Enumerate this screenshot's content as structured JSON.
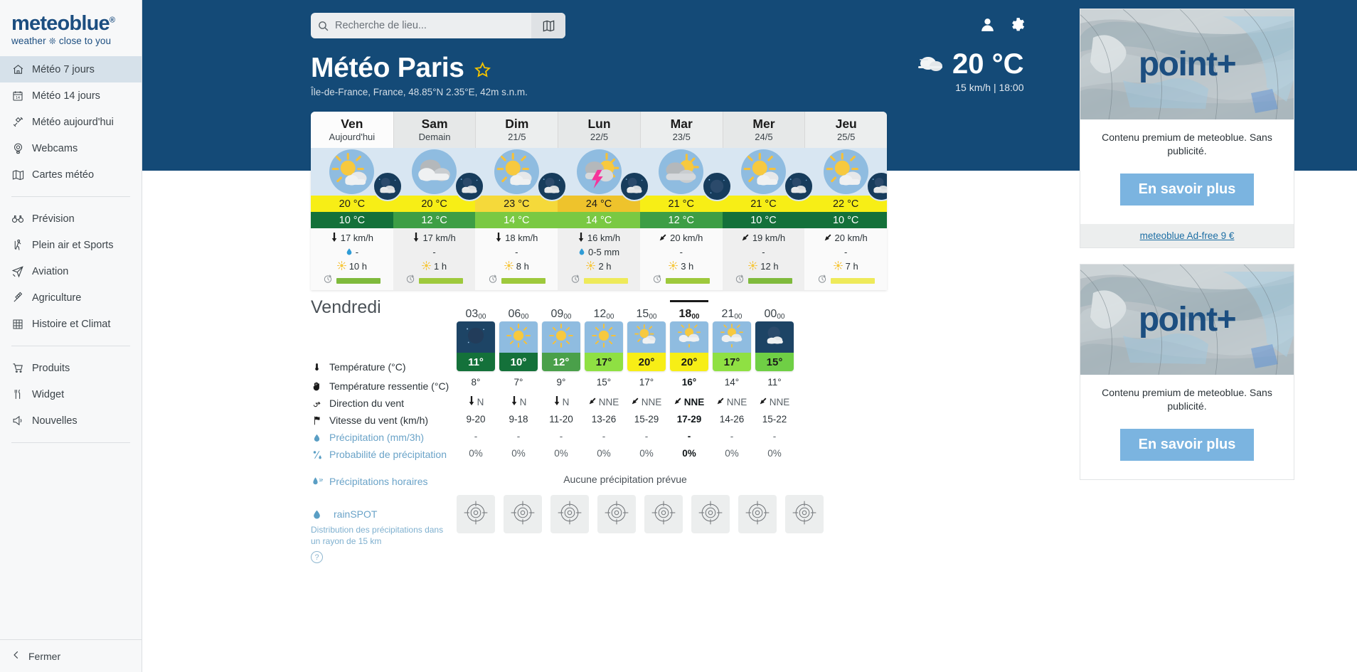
{
  "sidebar": {
    "logo": {
      "name": "meteoblue",
      "reg": "®",
      "tagline_left": "weather",
      "tagline_right": "close to you"
    },
    "items": [
      {
        "label": "Météo 7 jours",
        "icon": "home-icon",
        "active": true
      },
      {
        "label": "Météo 14 jours",
        "icon": "calendar-14-icon",
        "active": false
      },
      {
        "label": "Météo aujourd'hui",
        "icon": "satellite-icon",
        "active": false
      },
      {
        "label": "Webcams",
        "icon": "webcam-icon",
        "active": false
      },
      {
        "label": "Cartes météo",
        "icon": "map-icon",
        "active": false
      }
    ],
    "items2": [
      {
        "label": "Prévision",
        "icon": "binoculars-icon"
      },
      {
        "label": "Plein air et Sports",
        "icon": "hiker-icon"
      },
      {
        "label": "Aviation",
        "icon": "airplane-icon"
      },
      {
        "label": "Agriculture",
        "icon": "wheat-icon"
      },
      {
        "label": "Histoire et Climat",
        "icon": "table-icon"
      }
    ],
    "items3": [
      {
        "label": "Produits",
        "icon": "cart-icon"
      },
      {
        "label": "Widget",
        "icon": "tools-icon"
      },
      {
        "label": "Nouvelles",
        "icon": "megaphone-icon"
      }
    ],
    "close_label": "Fermer",
    "close_icon": "chevron-left-icon"
  },
  "header": {
    "search_placeholder": "Recherche de lieu...",
    "search_value": "",
    "search_icon": "search-icon",
    "map_icon": "map-book-icon",
    "user_icon": "user-icon",
    "gear_icon": "gear-icon",
    "title": "Météo Paris",
    "favorite_icon": "star-icon",
    "subtitle": "Île-de-France, France, 48.85°N 2.35°E, 42m s.n.m.",
    "current": {
      "icon": "cloudy-icon",
      "temperature": "20 °C",
      "meta": "15 km/h  | 18:00"
    }
  },
  "forecast": {
    "days": [
      {
        "name": "Ven",
        "date": "Aujourd'hui",
        "today": true,
        "day_icon": "sun-cloud-icon",
        "night_icon": "night-cloud-icon",
        "tmax": "20 °C",
        "tmin": "10 °C",
        "tmax_color": "#f7ee16",
        "tmin_color": "#14713a",
        "wind": "17 km/h",
        "wind_icon": "arrow-down-icon",
        "precip": "-",
        "precip_icon": "droplet-icon",
        "sun": "10 h",
        "sun_icon": "sun-small-icon",
        "bar_color": "#7fba3c",
        "bar_icon": "predictability-icon"
      },
      {
        "name": "Sam",
        "date": "Demain",
        "today": false,
        "day_icon": "clouds-icon",
        "night_icon": "night-cloud-icon",
        "tmax": "20 °C",
        "tmin": "12 °C",
        "tmax_color": "#f7ee16",
        "tmin_color": "#3d9e45",
        "wind": "17 km/h",
        "wind_icon": "arrow-down-icon",
        "precip": "-",
        "precip_icon": "none",
        "sun": "1 h",
        "sun_icon": "sun-small-icon",
        "bar_color": "#9ec93c",
        "bar_icon": "predictability-icon"
      },
      {
        "name": "Dim",
        "date": "21/5",
        "today": false,
        "day_icon": "sun-cloud-icon",
        "night_icon": "night-cloud-icon",
        "tmax": "23 °C",
        "tmin": "14 °C",
        "tmax_color": "#f5d93a",
        "tmin_color": "#7ac943",
        "wind": "18 km/h",
        "wind_icon": "arrow-down-icon",
        "precip": "-",
        "precip_icon": "none",
        "sun": "8 h",
        "sun_icon": "sun-small-icon",
        "bar_color": "#9ec93c",
        "bar_icon": "predictability-icon"
      },
      {
        "name": "Lun",
        "date": "22/5",
        "today": false,
        "day_icon": "thunder-sun-icon",
        "night_icon": "night-cloud-icon",
        "tmax": "24 °C",
        "tmin": "14 °C",
        "tmax_color": "#eec32c",
        "tmin_color": "#7ac943",
        "wind": "16 km/h",
        "wind_icon": "arrow-down-icon",
        "precip": "0-5 mm",
        "precip_icon": "droplet-icon",
        "sun": "2 h",
        "sun_icon": "sun-small-icon",
        "bar_color": "#eeea5a",
        "bar_icon": "predictability-icon"
      },
      {
        "name": "Mar",
        "date": "23/5",
        "today": false,
        "day_icon": "cloud-sun-icon",
        "night_icon": "night-moon-icon",
        "tmax": "21 °C",
        "tmin": "12 °C",
        "tmax_color": "#f7ee16",
        "tmin_color": "#3d9e45",
        "wind": "20 km/h",
        "wind_icon": "arrow-diag-icon",
        "precip": "-",
        "precip_icon": "none",
        "sun": "3 h",
        "sun_icon": "sun-small-icon",
        "bar_color": "#9ec93c",
        "bar_icon": "predictability-icon"
      },
      {
        "name": "Mer",
        "date": "24/5",
        "today": false,
        "day_icon": "sun-cloud-icon",
        "night_icon": "night-cloud-icon",
        "tmax": "21 °C",
        "tmin": "10 °C",
        "tmax_color": "#f7ee16",
        "tmin_color": "#14713a",
        "wind": "19 km/h",
        "wind_icon": "arrow-diag-icon",
        "precip": "-",
        "precip_icon": "none",
        "sun": "12 h",
        "sun_icon": "sun-small-icon",
        "bar_color": "#7fba3c",
        "bar_icon": "predictability-icon"
      },
      {
        "name": "Jeu",
        "date": "25/5",
        "today": false,
        "day_icon": "sun-cloud-icon",
        "night_icon": "night-cloud-icon",
        "tmax": "22 °C",
        "tmin": "10 °C",
        "tmax_color": "#f7ee16",
        "tmin_color": "#14713a",
        "wind": "20 km/h",
        "wind_icon": "arrow-diag-icon",
        "precip": "-",
        "precip_icon": "none",
        "sun": "7 h",
        "sun_icon": "sun-small-icon",
        "bar_color": "#eeea5a",
        "bar_icon": "predictability-icon"
      }
    ]
  },
  "hourly": {
    "day_title": "Vendredi",
    "labels": [
      {
        "text": "Température (°C)",
        "icon": "thermometer-icon",
        "blue": false
      },
      {
        "text": "Température ressentie (°C)",
        "icon": "hand-icon",
        "blue": false
      },
      {
        "text": "Direction du vent",
        "icon": "windvane-icon",
        "blue": false
      },
      {
        "text": "Vitesse du vent (km/h)",
        "icon": "flag-icon",
        "blue": false
      },
      {
        "text": "Précipitation (mm/3h)",
        "icon": "droplet-icon",
        "blue": true
      },
      {
        "text": "Probabilité de précipitation",
        "icon": "percent-drop-icon",
        "blue": true
      }
    ],
    "hourly_precip_label": "Précipitations horaires",
    "hourly_precip_icon": "droplet-1h-icon",
    "rainspot_label": "rainSPOT",
    "rainspot_icon": "droplet-icon",
    "rainspot_note": "Distribution des précipitations dans un rayon de 15 km",
    "help_label": "?",
    "no_precip_text": "Aucune précipitation prévue",
    "columns": [
      {
        "time": "03",
        "time_sup": "00",
        "selected": false,
        "sky": "night",
        "icon": "moon-icon",
        "temp": "11°",
        "temp_bg": "#14713a",
        "temp_color": "#ffffff",
        "feels": "8°",
        "wind_dir": "N",
        "wind_dir_icon": "arrow-down-icon",
        "wind_speed": "9-20",
        "precip": "-",
        "precip_prob": "0%"
      },
      {
        "time": "06",
        "time_sup": "00",
        "selected": false,
        "sky": "day",
        "icon": "sun-icon",
        "temp": "10°",
        "temp_bg": "#14713a",
        "temp_color": "#ffffff",
        "feels": "7°",
        "wind_dir": "N",
        "wind_dir_icon": "arrow-down-icon",
        "wind_speed": "9-18",
        "precip": "-",
        "precip_prob": "0%"
      },
      {
        "time": "09",
        "time_sup": "00",
        "selected": false,
        "sky": "day",
        "icon": "sun-icon",
        "temp": "12°",
        "temp_bg": "#4aa04a",
        "temp_color": "#ffffff",
        "feels": "9°",
        "wind_dir": "N",
        "wind_dir_icon": "arrow-down-icon",
        "wind_speed": "11-20",
        "precip": "-",
        "precip_prob": "0%"
      },
      {
        "time": "12",
        "time_sup": "00",
        "selected": false,
        "sky": "day",
        "icon": "sun-icon",
        "temp": "17°",
        "temp_bg": "#8fe043",
        "temp_color": "#1a1a1a",
        "feels": "15°",
        "wind_dir": "NNE",
        "wind_dir_icon": "arrow-diag-icon",
        "wind_speed": "13-26",
        "precip": "-",
        "precip_prob": "0%"
      },
      {
        "time": "15",
        "time_sup": "00",
        "selected": false,
        "sky": "day",
        "icon": "sun-cloud-icon",
        "temp": "20°",
        "temp_bg": "#f7ee16",
        "temp_color": "#1a1a1a",
        "feels": "17°",
        "wind_dir": "NNE",
        "wind_dir_icon": "arrow-diag-icon",
        "wind_speed": "15-29",
        "precip": "-",
        "precip_prob": "0%"
      },
      {
        "time": "18",
        "time_sup": "00",
        "selected": true,
        "sky": "day",
        "icon": "sun-clouds-icon",
        "temp": "20°",
        "temp_bg": "#f7ee16",
        "temp_color": "#1a1a1a",
        "feels": "16°",
        "wind_dir": "NNE",
        "wind_dir_icon": "arrow-diag-icon",
        "wind_speed": "17-29",
        "precip": "-",
        "precip_prob": "0%"
      },
      {
        "time": "21",
        "time_sup": "00",
        "selected": false,
        "sky": "day",
        "icon": "sun-clouds-icon",
        "temp": "17°",
        "temp_bg": "#8fe043",
        "temp_color": "#1a1a1a",
        "feels": "14°",
        "wind_dir": "NNE",
        "wind_dir_icon": "arrow-diag-icon",
        "wind_speed": "14-26",
        "precip": "-",
        "precip_prob": "0%"
      },
      {
        "time": "00",
        "time_sup": "00",
        "selected": false,
        "sky": "night",
        "icon": "moon-cloud-icon",
        "temp": "15°",
        "temp_bg": "#6fcf45",
        "temp_color": "#1a1a1a",
        "feels": "11°",
        "wind_dir": "NNE",
        "wind_dir_icon": "arrow-diag-icon",
        "wind_speed": "15-22",
        "precip": "-",
        "precip_prob": "0%"
      }
    ]
  },
  "ads": [
    {
      "banner_text": "point+",
      "text": "Contenu premium de meteoblue. Sans publicité.",
      "button": "En savoir plus",
      "footer_link": "meteoblue Ad-free 9 €",
      "has_footer": true
    },
    {
      "banner_text": "point+",
      "text": "Contenu premium de meteoblue. Sans publicité.",
      "button": "En savoir plus",
      "footer_link": "",
      "has_footer": false
    }
  ],
  "colors": {
    "brand": "#1c4e80",
    "header_bg": "#144a77",
    "accent": "#7bb4e0"
  }
}
